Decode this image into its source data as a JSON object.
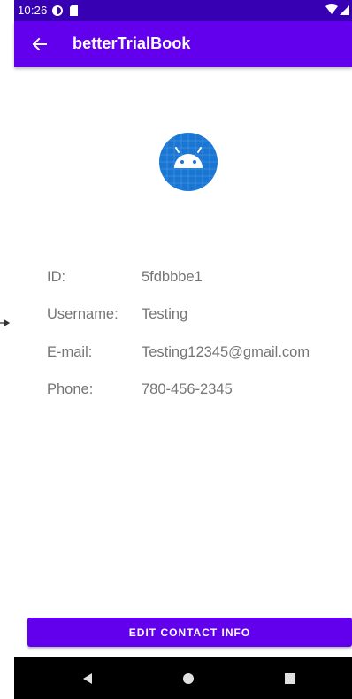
{
  "status_bar": {
    "time": "10:26",
    "icons": [
      "data-saver-icon",
      "sd-card-icon",
      "wifi-icon",
      "signal-icon"
    ]
  },
  "app_bar": {
    "title": "betterTrialBook",
    "back_icon": "arrow-back-icon"
  },
  "avatar": {
    "icon": "android-robot-icon"
  },
  "contact": {
    "rows": [
      {
        "label": "ID:",
        "value": "5fdbbbe1"
      },
      {
        "label": "Username:",
        "value": "Testing"
      },
      {
        "label": "E-mail:",
        "value": "Testing12345@gmail.com"
      },
      {
        "label": "Phone:",
        "value": "780-456-2345"
      }
    ]
  },
  "actions": {
    "edit_label": "EDIT CONTACT INFO"
  },
  "nav_bar": {
    "icons": [
      "back-triangle-icon",
      "home-circle-icon",
      "recents-square-icon"
    ]
  },
  "colors": {
    "status_bar": "#3700b3",
    "primary": "#6200ee",
    "text_secondary": "#757575",
    "avatar_bg": "#1976d2"
  }
}
